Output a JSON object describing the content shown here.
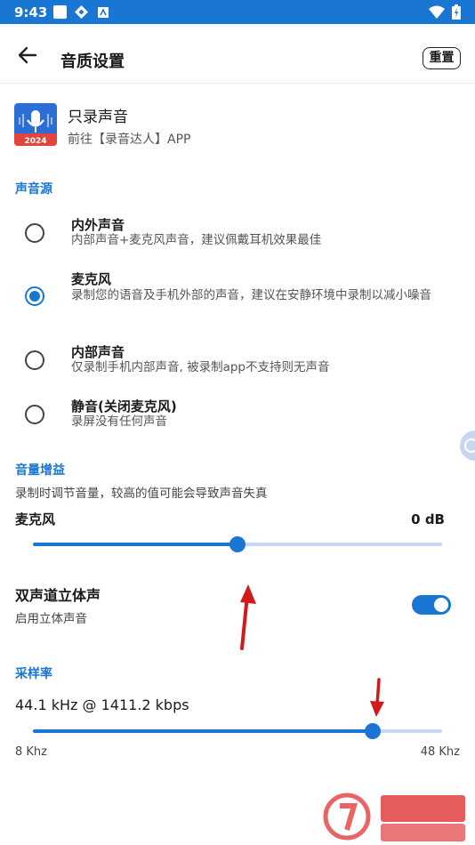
{
  "status_bar": {
    "time": "9:43"
  },
  "app_bar": {
    "title": "音质设置",
    "reset_label": "重置"
  },
  "app_promo": {
    "name": "只录声音",
    "link": "前往【录音达人】APP",
    "icon_badge": "2024"
  },
  "sound_source": {
    "label": "声音源",
    "selected_index": 1,
    "options": [
      {
        "title": "内外声音",
        "desc": "内部声音+麦克风声音，建议佩戴耳机效果最佳"
      },
      {
        "title": "麦克风",
        "desc": "录制您的语音及手机外部的声音，建议在安静环境中录制以减小噪音"
      },
      {
        "title": "内部声音",
        "desc": "仅录制手机内部声音, 被录制app不支持则无声音"
      },
      {
        "title": "静音(关闭麦克风)",
        "desc": "录屏没有任何声音"
      }
    ]
  },
  "volume_gain": {
    "label": "音量增益",
    "desc": "录制时调节音量，较高的值可能会导致声音失真",
    "mic_label": "麦克风",
    "value_text": "0 dB",
    "slider_fraction": 0.5
  },
  "stereo": {
    "title": "双声道立体声",
    "desc": "启用立体声音",
    "enabled": true
  },
  "sample_rate": {
    "label": "采样率",
    "value_text": "44.1 kHz @ 1411.2 kbps",
    "min_label": "8 Khz",
    "max_label": "48 Khz",
    "slider_fraction": 0.83
  },
  "colors": {
    "accent": "#1976d2",
    "track": "#c7d6f2",
    "annotation_arrow": "#d11a1a"
  }
}
